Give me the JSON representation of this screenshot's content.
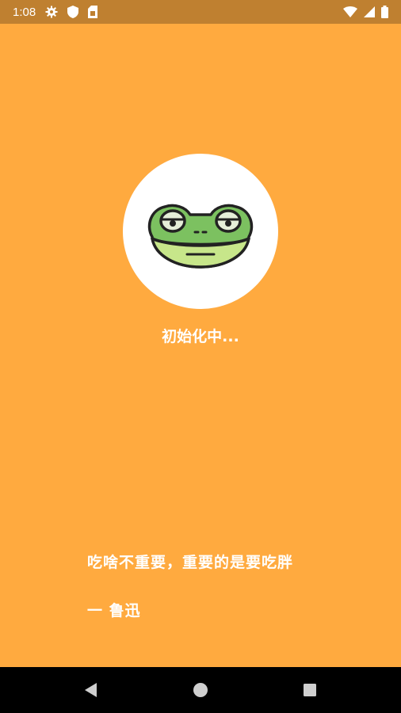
{
  "status_bar": {
    "time": "1:08",
    "icons_left": [
      "gear-icon",
      "shield-icon",
      "sim-card-icon"
    ],
    "icons_right": [
      "wifi-icon",
      "cell-signal-icon",
      "battery-icon"
    ]
  },
  "splash": {
    "logo": "frog-logo",
    "loading_text": "初始化中...",
    "quote": "吃啥不重要，重要的是要吃胖",
    "author": "一 鲁迅"
  },
  "nav_bar": {
    "buttons": [
      "back-icon",
      "home-icon",
      "recents-icon"
    ]
  },
  "colors": {
    "background": "#ffaa3f",
    "status_bar": "#bf8030",
    "frog_green": "#7cc160",
    "frog_mouth": "#c7e68a"
  }
}
